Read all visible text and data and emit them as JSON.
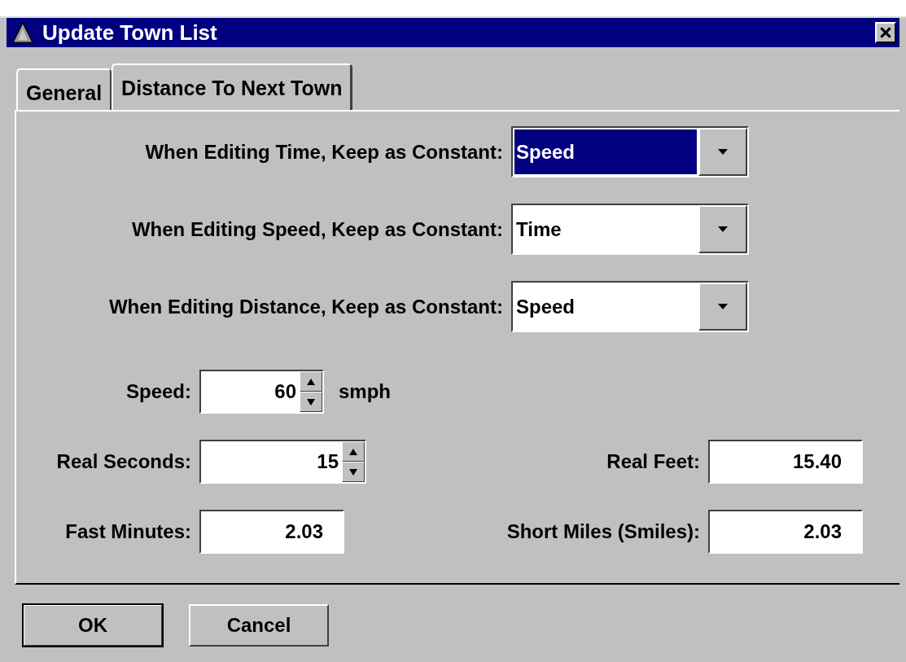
{
  "window": {
    "title": "Update Town List"
  },
  "tabs": [
    {
      "label": "General",
      "selected": false
    },
    {
      "label": "Distance To Next Town",
      "selected": true
    }
  ],
  "combos": [
    {
      "label": "When Editing Time, Keep as Constant:",
      "value": "Speed",
      "highlighted": true
    },
    {
      "label": "When Editing Speed, Keep as Constant:",
      "value": "Time",
      "highlighted": false
    },
    {
      "label": "When Editing Distance, Keep as Constant:",
      "value": "Speed",
      "highlighted": false
    }
  ],
  "speed_row": {
    "label": "Speed:",
    "value": "60",
    "kind": "spinner",
    "unit": "smph"
  },
  "left_fields": [
    {
      "label": "Real Seconds:",
      "value": "15",
      "kind": "spinner"
    },
    {
      "label": "Fast Minutes:",
      "value": "2.03",
      "kind": "text"
    }
  ],
  "right_fields": [
    {
      "label": "Real Feet:",
      "value": "15.40"
    },
    {
      "label": "Short Miles (Smiles):",
      "value": "2.03"
    }
  ],
  "buttons": [
    {
      "label": "OK",
      "default": true
    },
    {
      "label": "Cancel",
      "default": false
    }
  ]
}
